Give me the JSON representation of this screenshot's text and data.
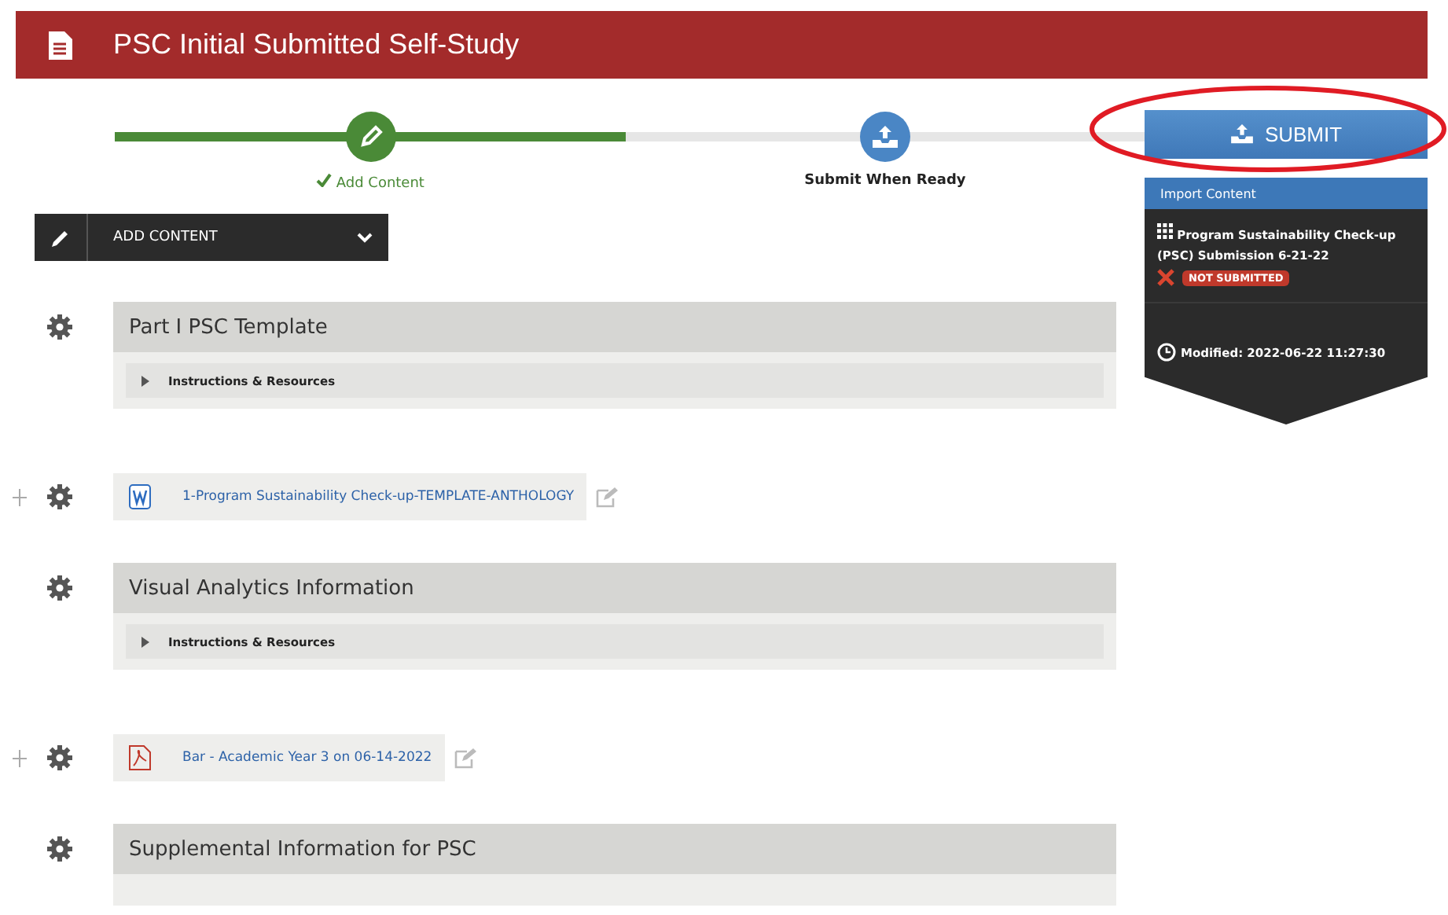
{
  "header": {
    "title": "PSC Initial Submitted Self-Study"
  },
  "steps": [
    {
      "label": "Add Content",
      "done": true
    },
    {
      "label": "Submit When Ready",
      "done": false
    }
  ],
  "add_menu": {
    "label": "ADD CONTENT"
  },
  "items": [
    {
      "kind": "section",
      "title": "Part I PSC Template",
      "expander": "Instructions & Resources"
    },
    {
      "kind": "word",
      "name": "1-Program Sustainability Check-up-TEMPLATE-ANTHOLOGY"
    },
    {
      "kind": "section",
      "title": "Visual Analytics Information",
      "expander": "Instructions & Resources"
    },
    {
      "kind": "pdf",
      "name": "Bar - Academic Year 3 on 06-14-2022"
    },
    {
      "kind": "section",
      "title": "Supplemental Information for PSC"
    }
  ],
  "submit": {
    "label": "SUBMIT"
  },
  "import": {
    "label": "Import Content"
  },
  "submission": {
    "title": "Program Sustainability Check-up (PSC) Submission 6-21-22",
    "status": "NOT SUBMITTED",
    "modified": "Modified: 2022-06-22 11:27:30"
  }
}
